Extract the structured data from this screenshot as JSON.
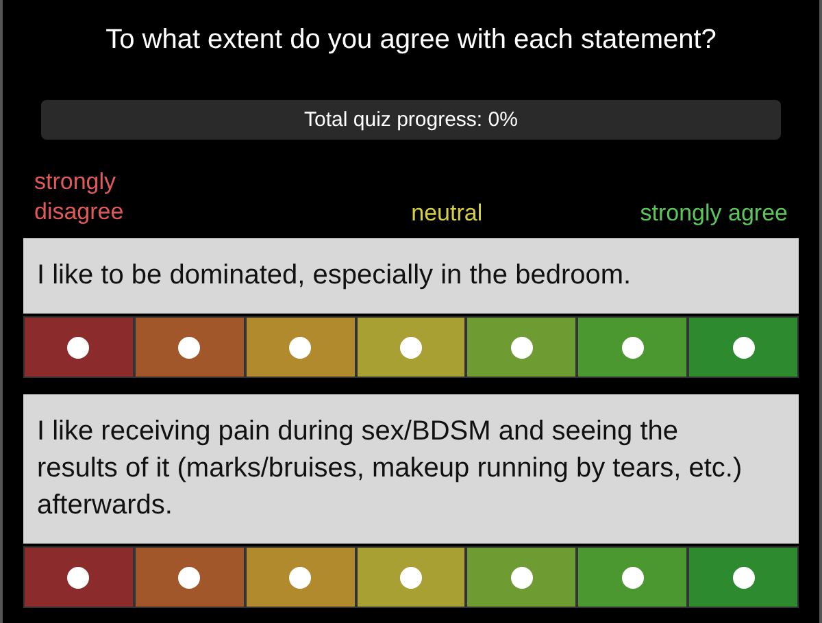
{
  "title": "To what extent do you agree with each statement?",
  "progress": {
    "label": "Total quiz progress: 0%"
  },
  "scale_labels": [
    {
      "text": "strongly disagree",
      "color": "#e05a5a"
    },
    {
      "text": "neutral",
      "color": "#d6d040"
    },
    {
      "text": "strongly agree",
      "color": "#5cc65c"
    }
  ],
  "questions": [
    {
      "statement": "I like to be dominated, especially in the bedroom.",
      "options": [
        {
          "color": "#8c2b2b",
          "selected": false
        },
        {
          "color": "#a2572b",
          "selected": false
        },
        {
          "color": "#b08a2c",
          "selected": false
        },
        {
          "color": "#a8a032",
          "selected": false
        },
        {
          "color": "#6e9c32",
          "selected": false
        },
        {
          "color": "#4c9830",
          "selected": false
        },
        {
          "color": "#2e8a2e",
          "selected": false
        }
      ]
    },
    {
      "statement": "I like receiving pain during sex/BDSM and seeing the results of it (marks/bruises, makeup running by tears, etc.) afterwards.",
      "options": [
        {
          "color": "#8c2b2b",
          "selected": false
        },
        {
          "color": "#a2572b",
          "selected": false
        },
        {
          "color": "#b08a2c",
          "selected": false
        },
        {
          "color": "#a8a032",
          "selected": false
        },
        {
          "color": "#6e9c32",
          "selected": false
        },
        {
          "color": "#4c9830",
          "selected": false
        },
        {
          "color": "#2e8a2e",
          "selected": false
        }
      ]
    }
  ]
}
